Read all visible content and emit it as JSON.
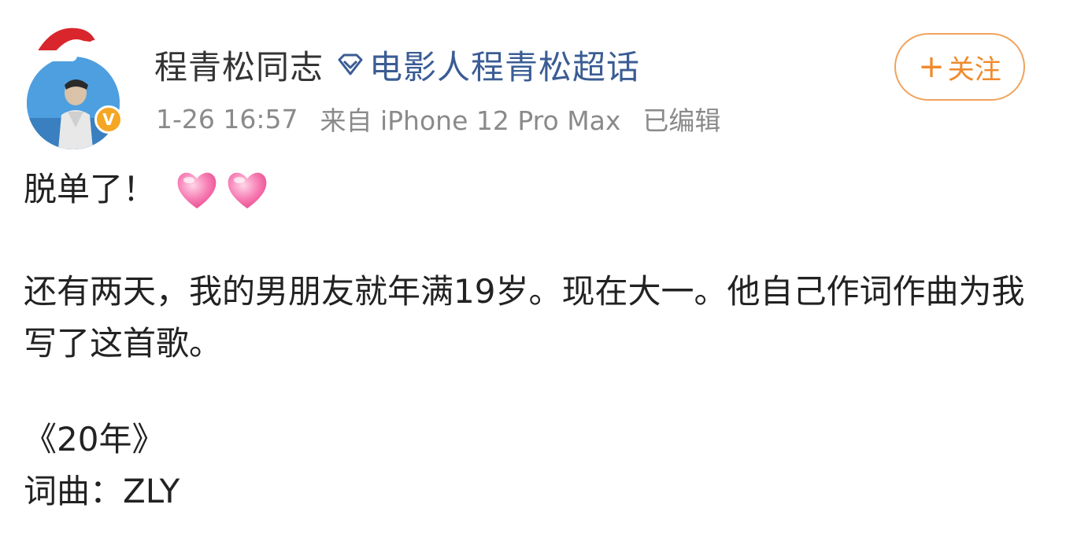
{
  "post": {
    "username": "程青松同志",
    "topic_link": "电影人程青松超话",
    "timestamp": "1-26 16:57",
    "source": "来自 iPhone 12 Pro Max",
    "edited": "已编辑",
    "follow": {
      "plus": "+",
      "label": "关注"
    }
  },
  "content": {
    "line1": "脱单了！",
    "para1": "还有两天，我的男朋友就年满19岁。现在大一。他自己作词作曲为我写了这首歌。",
    "song_title": "《20年》",
    "credits": "词曲：ZLY"
  },
  "icons": {
    "avatar": "avatar",
    "santa_hat": "santa-hat-icon",
    "verified": "verified-badge-icon",
    "topic": "diamond-topic-icon",
    "heart": "pink-heart-icon"
  },
  "colors": {
    "accent_orange": "#f08a2c",
    "link_blue": "#3b5c94",
    "meta_gray": "#8a8a8a",
    "heart_pink": "#f25c9a"
  }
}
